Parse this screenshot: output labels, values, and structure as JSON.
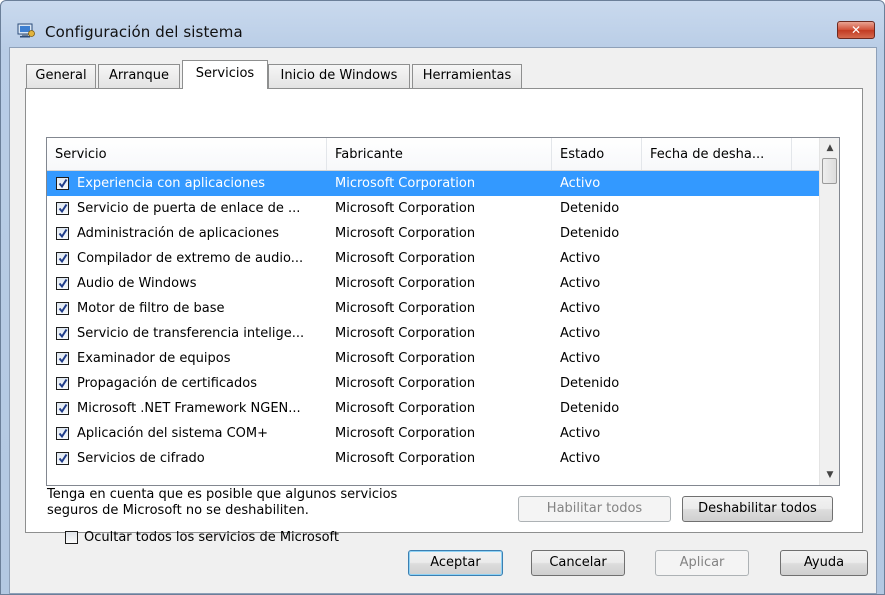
{
  "window": {
    "title": "Configuración del sistema",
    "close_label": "✕"
  },
  "tabs": [
    {
      "label": "General",
      "active": false
    },
    {
      "label": "Arranque",
      "active": false
    },
    {
      "label": "Servicios",
      "active": true
    },
    {
      "label": "Inicio de Windows",
      "active": false
    },
    {
      "label": "Herramientas",
      "active": false
    }
  ],
  "table": {
    "columns": [
      "Servicio",
      "Fabricante",
      "Estado",
      "Fecha de desha..."
    ],
    "rows": [
      {
        "checked": true,
        "service": "Experiencia con aplicaciones",
        "maker": "Microsoft Corporation",
        "status": "Activo",
        "date": "",
        "selected": true
      },
      {
        "checked": true,
        "service": "Servicio de puerta de enlace de ...",
        "maker": "Microsoft Corporation",
        "status": "Detenido",
        "date": ""
      },
      {
        "checked": true,
        "service": "Administración de aplicaciones",
        "maker": "Microsoft Corporation",
        "status": "Detenido",
        "date": ""
      },
      {
        "checked": true,
        "service": "Compilador de extremo de audio...",
        "maker": "Microsoft Corporation",
        "status": "Activo",
        "date": ""
      },
      {
        "checked": true,
        "service": "Audio de Windows",
        "maker": "Microsoft Corporation",
        "status": "Activo",
        "date": ""
      },
      {
        "checked": true,
        "service": "Motor de filtro de base",
        "maker": "Microsoft Corporation",
        "status": "Activo",
        "date": ""
      },
      {
        "checked": true,
        "service": "Servicio de transferencia intelige...",
        "maker": "Microsoft Corporation",
        "status": "Activo",
        "date": ""
      },
      {
        "checked": true,
        "service": "Examinador de equipos",
        "maker": "Microsoft Corporation",
        "status": "Activo",
        "date": ""
      },
      {
        "checked": true,
        "service": "Propagación de certificados",
        "maker": "Microsoft Corporation",
        "status": "Detenido",
        "date": ""
      },
      {
        "checked": true,
        "service": "Microsoft .NET Framework NGEN...",
        "maker": "Microsoft Corporation",
        "status": "Detenido",
        "date": ""
      },
      {
        "checked": true,
        "service": "Aplicación del sistema COM+",
        "maker": "Microsoft Corporation",
        "status": "Activo",
        "date": ""
      },
      {
        "checked": true,
        "service": "Servicios de cifrado",
        "maker": "Microsoft Corporation",
        "status": "Activo",
        "date": ""
      }
    ]
  },
  "note": {
    "line1": "Tenga en cuenta que es posible que algunos servicios",
    "line2": "seguros de Microsoft no se deshabiliten."
  },
  "buttons": {
    "enable_all": "Habilitar todos",
    "disable_all": "Deshabilitar todos",
    "ok": "Aceptar",
    "cancel": "Cancelar",
    "apply": "Aplicar",
    "help": "Ayuda"
  },
  "hide_ms": {
    "label": "Ocultar todos los servicios de Microsoft",
    "checked": false
  },
  "colors": {
    "selection": "#3399ff",
    "frame": "#b9cde6"
  }
}
